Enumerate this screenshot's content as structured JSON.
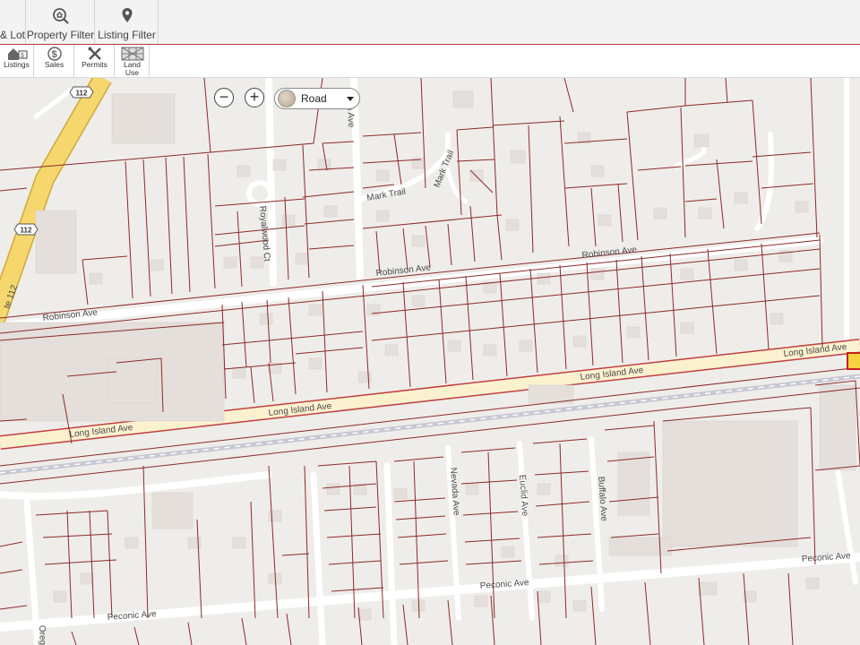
{
  "toolbar": {
    "tabs": [
      {
        "label": "& Lot",
        "icon": "none"
      },
      {
        "label": "Property Filter",
        "icon": "house-search-icon"
      },
      {
        "label": "Listing Filter",
        "icon": "map-pin-icon"
      }
    ]
  },
  "subtoolbar": {
    "buttons": [
      {
        "label": "Listings",
        "icon": "house-listing-icon"
      },
      {
        "label": "Sales",
        "icon": "dollar-icon"
      },
      {
        "label": "Permits",
        "icon": "tools-icon"
      },
      {
        "label_line1": "Land",
        "label_line2": "Use",
        "icon": "grid-land-use-icon"
      }
    ]
  },
  "map_controls": {
    "zoom_out": "−",
    "zoom_in": "+",
    "layer_value": "Road"
  },
  "map": {
    "route_shield_1": "112",
    "route_shield_2": "112",
    "labels": {
      "route_112": "te 112",
      "robinson_ave_1": "Robinson Ave",
      "robinson_ave_2": "Robinson Ave",
      "robinson_ave_3": "Robinson Ave",
      "long_island_ave_1": "Long Island Ave",
      "long_island_ave_2": "Long Island Ave",
      "long_island_ave_3": "Long Island Ave",
      "long_island_ave_4": "Long Island Ave",
      "mark_trail_1": "Mark Trail",
      "mark_trail_2": "Mark Trail",
      "royalwood_ct": "Royalwood Ct",
      "nia_ave": "nia Ave",
      "nevada_ave": "Nevada Ave",
      "euclid_ave": "Euclid Ave",
      "buffalo_ave": "Buffalo Ave",
      "peconic_ave_1": "Peconic Ave",
      "peconic_ave_2": "Peconic Ave",
      "peconic_ave_3": "Peconic Ave",
      "oreg": "Oreg"
    }
  },
  "colors": {
    "parcel_line": "#8b2a2a",
    "road_fill": "#ffffff",
    "highway": "#f5d76e",
    "main_ave": "#fbf1cf",
    "building": "#e4dfda",
    "map_bg": "#efedea",
    "highlight": "#f4d33c"
  }
}
